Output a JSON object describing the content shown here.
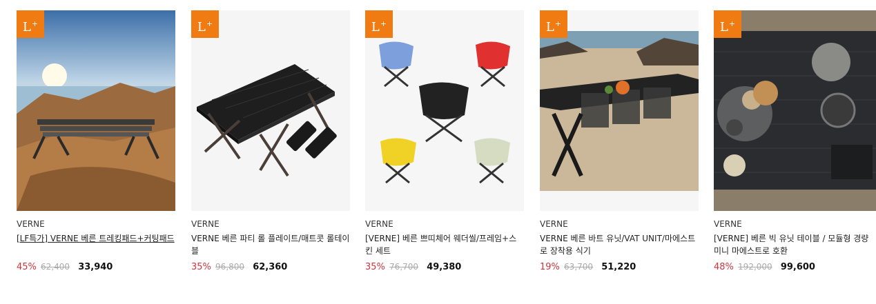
{
  "badge": {
    "text": "L",
    "sup": "+"
  },
  "products": [
    {
      "brand": "VERNE",
      "name": "[LF특가] VERNE 베른 트레킹패드+커팅패드",
      "discount": "45%",
      "original_price": "62,400",
      "sale_price": "33,940"
    },
    {
      "brand": "VERNE",
      "name": "VERNE 베른 파티 롤 플레이트/매트콧 롤테이블",
      "discount": "35%",
      "original_price": "96,800",
      "sale_price": "62,360"
    },
    {
      "brand": "VERNE",
      "name": "[VERNE] 베른 쁘띠체어 웨더씰/프레임+스킨 세트",
      "discount": "35%",
      "original_price": "76,700",
      "sale_price": "49,380"
    },
    {
      "brand": "VERNE",
      "name": "VERNE 베른 바트 유닛/VAT UNIT/마에스트로 장착용 식기",
      "discount": "19%",
      "original_price": "63,700",
      "sale_price": "51,220"
    },
    {
      "brand": "VERNE",
      "name": "[VERNE] 베른 빅 유닛 테이블 / 모듈형 경량 미니 마에스트로 호환",
      "discount": "48%",
      "original_price": "192,000",
      "sale_price": "99,600"
    }
  ]
}
